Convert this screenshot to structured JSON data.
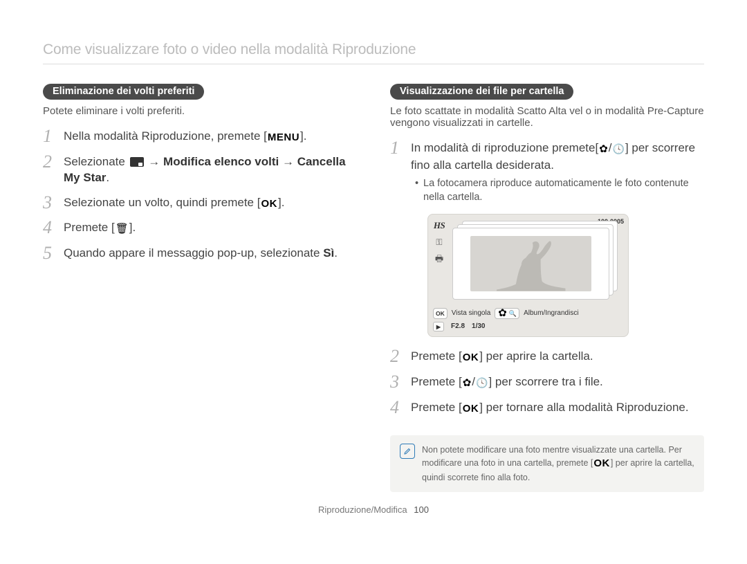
{
  "page_title": "Come visualizzare foto o video nella modalità Riproduzione",
  "left": {
    "pill": "Eliminazione dei volti preferiti",
    "desc": "Potete eliminare i volti preferiti.",
    "steps": {
      "s1_a": "Nella modalità Riproduzione, premete [",
      "s1_menu": "MENU",
      "s1_b": "].",
      "s2_a": "Selezionate ",
      "s2_b": " → ",
      "s2_bold1": "Modifica elenco volti",
      "s2_c": " → ",
      "s2_bold2": "Cancella My Star",
      "s2_d": ".",
      "s3_a": "Selezionate un volto, quindi premete [",
      "s3_ok": "OK",
      "s3_b": "].",
      "s4_a": "Premete [",
      "s4_trash": "trash-icon",
      "s4_b": "].",
      "s5_a": "Quando appare il messaggio pop-up, selezionate ",
      "s5_bold": "Sì",
      "s5_b": "."
    }
  },
  "right": {
    "pill": "Visualizzazione dei file per cartella",
    "desc": "Le foto scattate in modalità Scatto Alta vel o in modalità Pre-Capture vengono visualizzati in cartelle.",
    "steps": {
      "s1_a": "In modalità di riproduzione premete[",
      "s1_b": "/",
      "s1_c": "] per scorrere fino alla cartella desiderata.",
      "s1_sub": "La fotocamera riproduce automaticamente le foto contenute nella cartella.",
      "s2_a": "Premete [",
      "s2_ok": "OK",
      "s2_b": "] per aprire la cartella.",
      "s3_a": "Premete [",
      "s3_b": "/",
      "s3_c": "] per scorrere tra i file.",
      "s4_a": "Premete [",
      "s4_ok": "OK",
      "s4_b": "] per tornare alla modalità Riproduzione."
    },
    "screen": {
      "hs_badge": "HS",
      "counter": "100-0005",
      "bar_ok": "OK",
      "bar_view": "Vista singola",
      "bar_zoom": "Album/Ingrandisci",
      "aperture": "F2.8",
      "shutter": "1/30"
    },
    "note_a": "Non potete modificare una foto mentre visualizzate una cartella. Per modificare una foto in una cartella, premete [",
    "note_ok": "OK",
    "note_b": "] per aprire la cartella, quindi scorrete fino alla foto."
  },
  "footer": {
    "section": "Riproduzione/Modifica",
    "page": "100"
  }
}
